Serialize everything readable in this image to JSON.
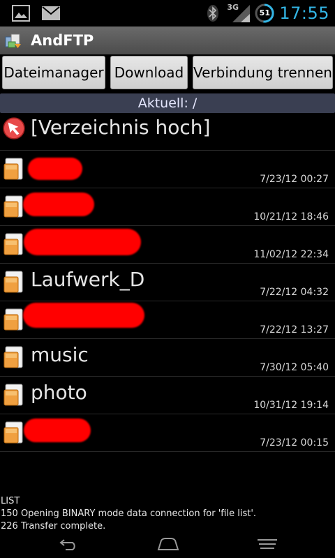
{
  "status_bar": {
    "time": "17:55",
    "battery_level": "51",
    "network": "3G",
    "icons": [
      "picture-icon",
      "mail-icon",
      "bluetooth-icon",
      "signal-icon",
      "battery-icon"
    ]
  },
  "app": {
    "title": "AndFTP",
    "icon": "andftp-logo-icon"
  },
  "toolbar": {
    "file_manager_label": "Dateimanager",
    "download_label": "Download",
    "disconnect_label": "Verbindung trennen"
  },
  "path": {
    "label": "Aktuell: /"
  },
  "files": {
    "up": {
      "name": "[Verzeichnis hoch]",
      "icon": "folder-up-icon"
    },
    "items": [
      {
        "name": "",
        "date": "7/23/12 00:27",
        "icon": "folder-icon",
        "redacted": true
      },
      {
        "name": "",
        "date": "10/21/12 18:46",
        "icon": "folder-icon",
        "redacted": true
      },
      {
        "name": "",
        "date": "11/02/12 22:34",
        "icon": "folder-icon",
        "redacted": true
      },
      {
        "name": "Laufwerk_D",
        "date": "7/22/12 04:32",
        "icon": "folder-icon",
        "redacted": false
      },
      {
        "name": "",
        "date": "7/22/12 13:27",
        "icon": "folder-icon",
        "redacted": true
      },
      {
        "name": "music",
        "date": "7/30/12 05:40",
        "icon": "folder-icon",
        "redacted": false
      },
      {
        "name": "photo",
        "date": "10/31/12 19:14",
        "icon": "folder-icon",
        "redacted": false
      },
      {
        "name": "",
        "date": "7/23/12 00:15",
        "icon": "folder-icon",
        "redacted": true
      }
    ]
  },
  "log": {
    "lines": [
      "LIST",
      "150 Opening BINARY mode data connection for 'file list'.",
      "226 Transfer complete."
    ]
  },
  "nav_bar": {
    "icons": [
      "back-icon",
      "home-icon",
      "recent-apps-icon"
    ]
  },
  "colors": {
    "accent": "#33b5e5",
    "redaction": "#ff0000",
    "path_bar": "#3a3f52"
  }
}
